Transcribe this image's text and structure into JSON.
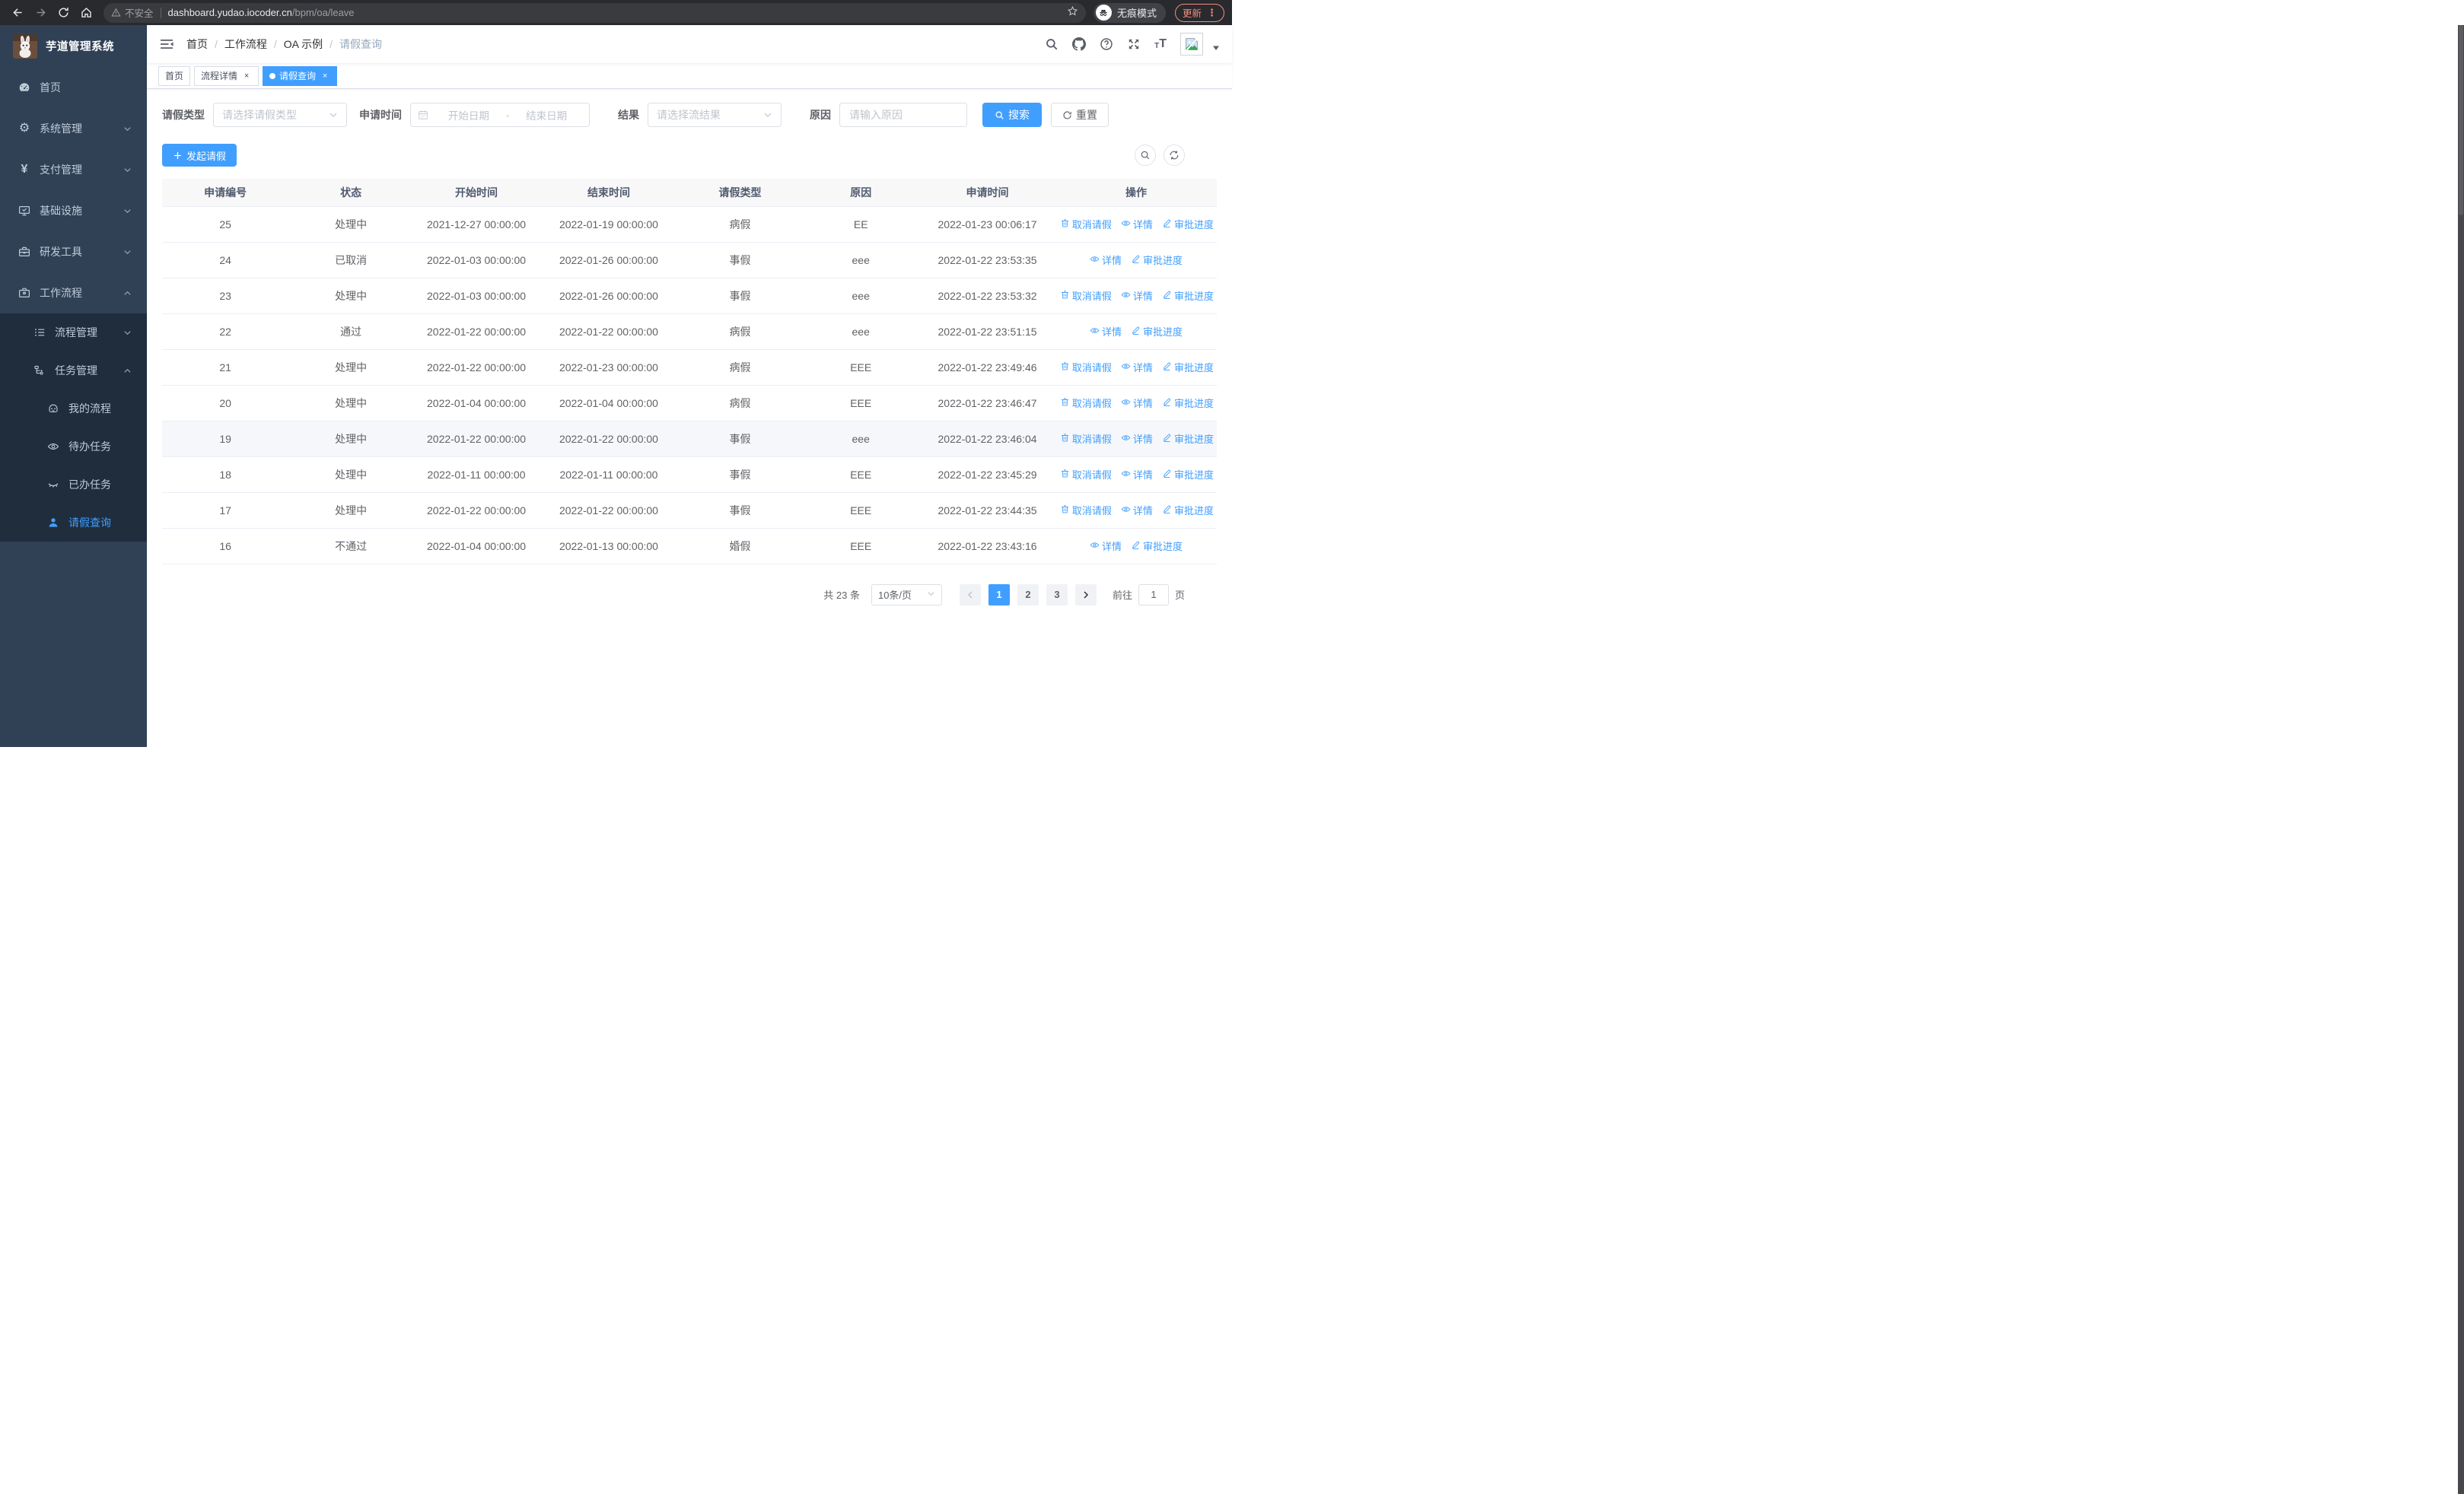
{
  "browser": {
    "security_label": "不安全",
    "url_host": "dashboard.yudao.iocoder.cn",
    "url_path": "/bpm/oa/leave",
    "incognito_label": "无痕模式",
    "update_label": "更新"
  },
  "sidebar": {
    "title": "芋道管理系统",
    "items": [
      {
        "key": "home",
        "label": "首页",
        "icon": "dashboard-icon",
        "level": 1
      },
      {
        "key": "system-management",
        "label": "系统管理",
        "icon": "gear-icon",
        "level": 1,
        "chevron": "down"
      },
      {
        "key": "payment-management",
        "label": "支付管理",
        "icon": "yen-icon",
        "level": 1,
        "chevron": "down"
      },
      {
        "key": "infrastructure",
        "label": "基础设施",
        "icon": "monitor-icon",
        "level": 1,
        "chevron": "down"
      },
      {
        "key": "dev-tools",
        "label": "研发工具",
        "icon": "toolbox-icon",
        "level": 1,
        "chevron": "down"
      },
      {
        "key": "workflow",
        "label": "工作流程",
        "icon": "briefcase-icon",
        "level": 1,
        "chevron": "up"
      },
      {
        "key": "process-management",
        "label": "流程管理",
        "icon": "list-icon",
        "level": 2,
        "chevron": "down"
      },
      {
        "key": "task-management",
        "label": "任务管理",
        "icon": "tree-icon",
        "level": 2,
        "chevron": "up"
      },
      {
        "key": "my-process",
        "label": "我的流程",
        "icon": "face-icon",
        "level": 3
      },
      {
        "key": "todo-tasks",
        "label": "待办任务",
        "icon": "eye-icon",
        "level": 3
      },
      {
        "key": "done-tasks",
        "label": "已办任务",
        "icon": "eye-closed-icon",
        "level": 3
      },
      {
        "key": "leave-query",
        "label": "请假查询",
        "icon": "user-icon",
        "level": 3,
        "active": true
      }
    ]
  },
  "header": {
    "breadcrumb": [
      "首页",
      "工作流程",
      "OA 示例",
      "请假查询"
    ],
    "separator": "/"
  },
  "tabs": [
    {
      "label": "首页",
      "closable": false,
      "active": false
    },
    {
      "label": "流程详情",
      "closable": true,
      "active": false
    },
    {
      "label": "请假查询",
      "closable": true,
      "active": true
    }
  ],
  "filters": {
    "leave_type": {
      "label": "请假类型",
      "placeholder": "请选择请假类型"
    },
    "apply_time": {
      "label": "申请时间",
      "start_placeholder": "开始日期",
      "separator": "-",
      "end_placeholder": "结束日期"
    },
    "result": {
      "label": "结果",
      "placeholder": "请选择流结果"
    },
    "reason": {
      "label": "原因",
      "placeholder": "请输入原因"
    },
    "search_label": "搜索",
    "reset_label": "重置"
  },
  "toolbar": {
    "create_label": "发起请假"
  },
  "table": {
    "columns": [
      "申请编号",
      "状态",
      "开始时间",
      "结束时间",
      "请假类型",
      "原因",
      "申请时间",
      "操作"
    ],
    "action_labels": {
      "cancel": "取消请假",
      "detail": "详情",
      "progress": "审批进度"
    },
    "rows": [
      {
        "id": "25",
        "status": "处理中",
        "start": "2021-12-27 00:00:00",
        "end": "2022-01-19 00:00:00",
        "type": "病假",
        "reason": "EE",
        "apply_time": "2022-01-23 00:06:17",
        "actions": [
          "cancel",
          "detail",
          "progress"
        ]
      },
      {
        "id": "24",
        "status": "已取消",
        "start": "2022-01-03 00:00:00",
        "end": "2022-01-26 00:00:00",
        "type": "事假",
        "reason": "eee",
        "apply_time": "2022-01-22 23:53:35",
        "actions": [
          "detail",
          "progress"
        ]
      },
      {
        "id": "23",
        "status": "处理中",
        "start": "2022-01-03 00:00:00",
        "end": "2022-01-26 00:00:00",
        "type": "事假",
        "reason": "eee",
        "apply_time": "2022-01-22 23:53:32",
        "actions": [
          "cancel",
          "detail",
          "progress"
        ]
      },
      {
        "id": "22",
        "status": "通过",
        "start": "2022-01-22 00:00:00",
        "end": "2022-01-22 00:00:00",
        "type": "病假",
        "reason": "eee",
        "apply_time": "2022-01-22 23:51:15",
        "actions": [
          "detail",
          "progress"
        ]
      },
      {
        "id": "21",
        "status": "处理中",
        "start": "2022-01-22 00:00:00",
        "end": "2022-01-23 00:00:00",
        "type": "病假",
        "reason": "EEE",
        "apply_time": "2022-01-22 23:49:46",
        "actions": [
          "cancel",
          "detail",
          "progress"
        ]
      },
      {
        "id": "20",
        "status": "处理中",
        "start": "2022-01-04 00:00:00",
        "end": "2022-01-04 00:00:00",
        "type": "病假",
        "reason": "EEE",
        "apply_time": "2022-01-22 23:46:47",
        "actions": [
          "cancel",
          "detail",
          "progress"
        ]
      },
      {
        "id": "19",
        "status": "处理中",
        "start": "2022-01-22 00:00:00",
        "end": "2022-01-22 00:00:00",
        "type": "事假",
        "reason": "eee",
        "apply_time": "2022-01-22 23:46:04",
        "actions": [
          "cancel",
          "detail",
          "progress"
        ],
        "highlighted": true
      },
      {
        "id": "18",
        "status": "处理中",
        "start": "2022-01-11 00:00:00",
        "end": "2022-01-11 00:00:00",
        "type": "事假",
        "reason": "EEE",
        "apply_time": "2022-01-22 23:45:29",
        "actions": [
          "cancel",
          "detail",
          "progress"
        ]
      },
      {
        "id": "17",
        "status": "处理中",
        "start": "2022-01-22 00:00:00",
        "end": "2022-01-22 00:00:00",
        "type": "事假",
        "reason": "EEE",
        "apply_time": "2022-01-22 23:44:35",
        "actions": [
          "cancel",
          "detail",
          "progress"
        ]
      },
      {
        "id": "16",
        "status": "不通过",
        "start": "2022-01-04 00:00:00",
        "end": "2022-01-13 00:00:00",
        "type": "婚假",
        "reason": "EEE",
        "apply_time": "2022-01-22 23:43:16",
        "actions": [
          "detail",
          "progress"
        ]
      }
    ]
  },
  "pagination": {
    "total_label": "共 23 条",
    "page_size": "10条/页",
    "pages": [
      "1",
      "2",
      "3"
    ],
    "active_page": "1",
    "goto_label": "前往",
    "goto_value": "1",
    "goto_suffix": "页"
  },
  "colors": {
    "accent": "#409eff",
    "sidebar_bg": "#304156",
    "submenu_bg": "#1f2d3d",
    "update_accent": "#f28b82"
  }
}
